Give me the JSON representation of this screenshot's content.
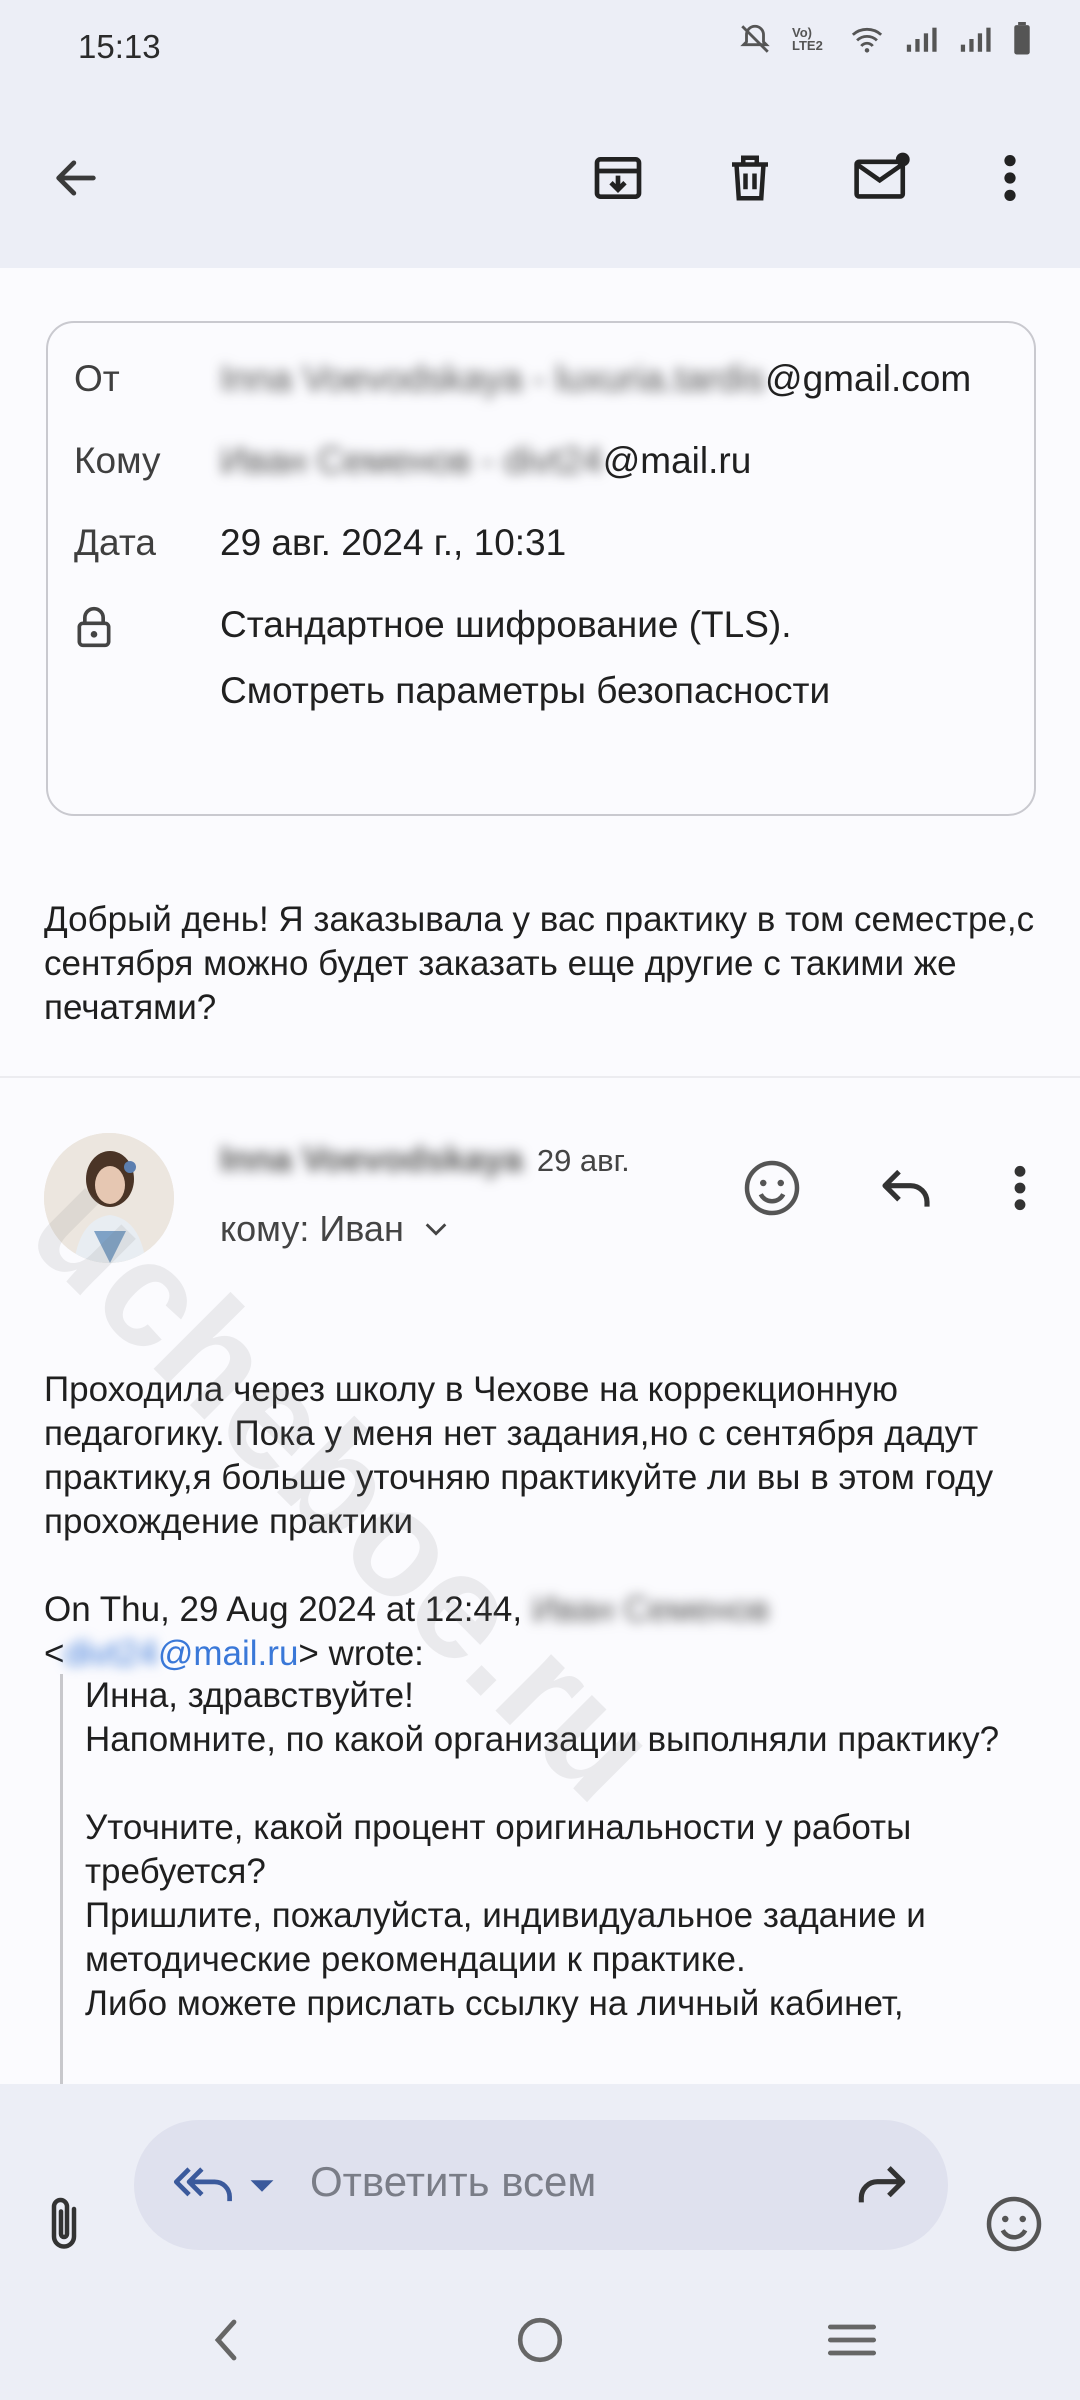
{
  "status_bar": {
    "time": "15:13",
    "network_label": "Vo) LTE2"
  },
  "app_bar": {
    "icons": [
      "back-arrow-icon",
      "archive-icon",
      "delete-icon",
      "mark-unread-icon",
      "more-vert-icon"
    ]
  },
  "details": {
    "from_label": "От",
    "from_value_hidden": "Inna Voevodskaya - luxuria.tardis",
    "from_domain": "@gmail.com",
    "to_label": "Кому",
    "to_value_hidden": "Иван Семенов - divt24",
    "to_domain": "@mail.ru",
    "date_label": "Дата",
    "date_value": "29 авг. 2024 г., 10:31",
    "encryption": "Стандартное шифрование (TLS).",
    "security_link": "Смотреть параметры безопасности"
  },
  "first_message": "Добрый день! Я заказывала у вас практику в том семестре,с сентября можно будет заказать еще другие с такими же печатями?",
  "second_message": {
    "sender_hidden": "Inna Voevodskaya",
    "date": "29 авг.",
    "to": "кому: Иван",
    "body": "Проходила через школу в Чехове на коррекционную педагогику. Пока у меня нет задания,но с сентября дадут практику,я больше уточняю практикуйте ли вы в этом году прохождение практики",
    "quote_header_start": "On Thu, 29 Aug 2024 at 12:44,",
    "quote_header_name_hidden": "Иван Семенов",
    "quote_email_prefix": "<",
    "quote_email_hidden": "divt24",
    "quote_email_domain": "@mail.ru",
    "quote_email_suffix": "> wrote:",
    "quote_lines": [
      "Инна, здравствуйте!",
      "Напомните, по какой организации выполняли практику?",
      "",
      "Уточните, какой процент оригинальности у работы требуется?",
      "Пришлите, пожалуйста, индивидуальное задание и методические рекомендации к практике.",
      "Либо можете прислать ссылку на личный кабинет,"
    ]
  },
  "reply_bar": {
    "placeholder": "Ответить всем"
  },
  "watermark": "ucheboe.ru"
}
